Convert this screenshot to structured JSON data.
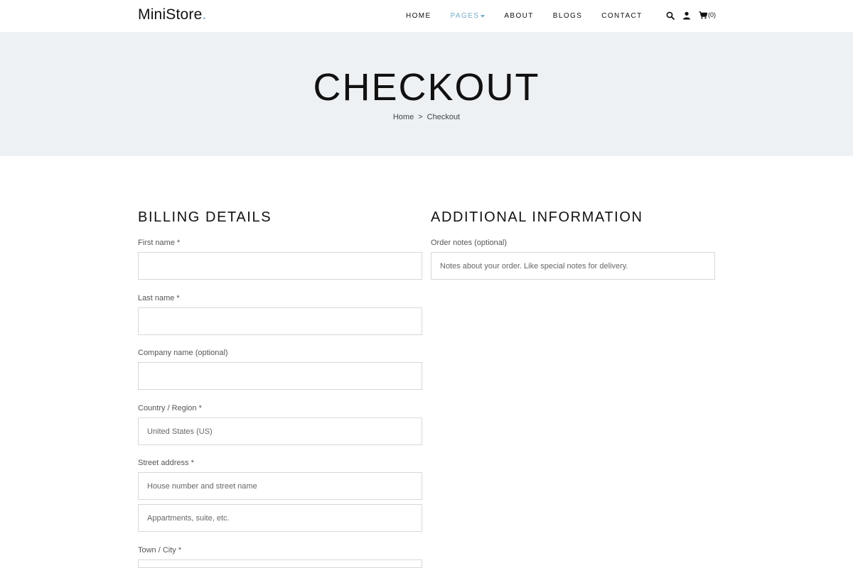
{
  "header": {
    "logo_main": "MiniStore",
    "logo_dot": ".",
    "nav": [
      {
        "label": "HOME"
      },
      {
        "label": "PAGES"
      },
      {
        "label": "ABOUT"
      },
      {
        "label": "BLOGS"
      },
      {
        "label": "CONTACT"
      }
    ],
    "cart_count": "(0)",
    "accent_color": "#72aec8"
  },
  "hero": {
    "title": "CHECKOUT",
    "breadcrumb_home": "Home",
    "breadcrumb_sep": ">",
    "breadcrumb_current": "Checkout"
  },
  "billing": {
    "title": "BILLING DETAILS",
    "first_name_label": "First name *",
    "last_name_label": "Last name *",
    "company_label": "Company name (optional)",
    "country_label": "Country / Region *",
    "country_value": "United States (US)",
    "street_label": "Street address *",
    "street_placeholder": "House number and street name",
    "apt_placeholder": "Appartments, suite, etc.",
    "city_label": "Town / City *"
  },
  "additional": {
    "title": "ADDITIONAL INFORMATION",
    "notes_label": "Order notes (optional)",
    "notes_placeholder": "Notes about your order. Like special notes for delivery."
  }
}
